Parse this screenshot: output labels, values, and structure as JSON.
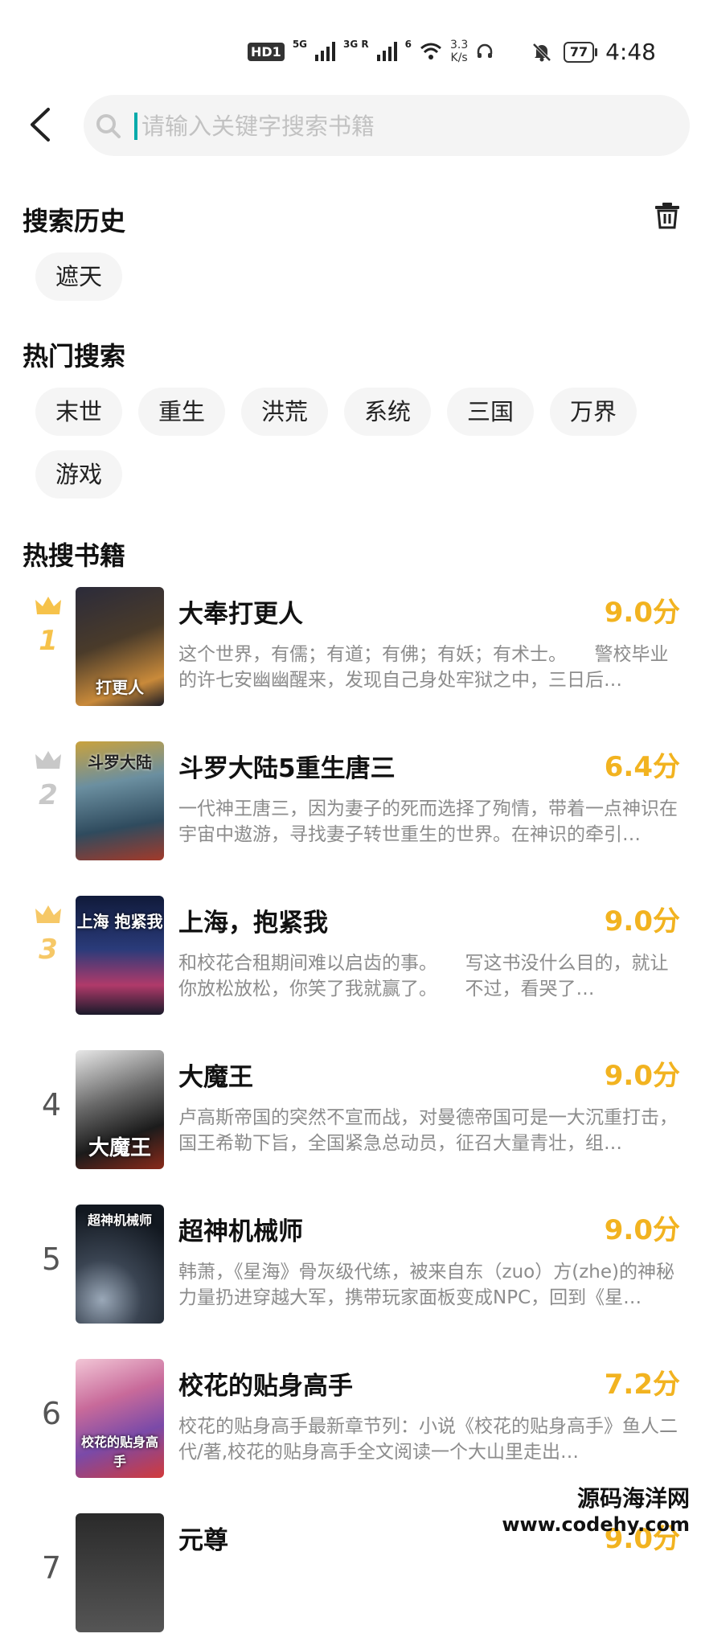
{
  "status_bar": {
    "hd": "HD",
    "sim": "1",
    "net1": "5G",
    "net2": "3G R",
    "wifi_gen": "6",
    "speed_value": "3.3",
    "speed_unit": "K/s",
    "battery": "77",
    "time": "4:48"
  },
  "search": {
    "placeholder": "请输入关键字搜索书籍"
  },
  "history": {
    "title": "搜索历史",
    "items": [
      "遮天"
    ]
  },
  "hot": {
    "title": "热门搜索",
    "items": [
      "末世",
      "重生",
      "洪荒",
      "系统",
      "三国",
      "万界",
      "游戏"
    ]
  },
  "books": {
    "title": "热搜书籍",
    "items": [
      {
        "rank": "1",
        "title": "大奉打更人",
        "score": "9.0分",
        "desc": "这个世界，有儒；有道；有佛；有妖；有术士。　　警校毕业的许七安幽幽醒来，发现自己身处牢狱之中，三日后…",
        "cover_text": "打更人"
      },
      {
        "rank": "2",
        "title": "斗罗大陆5重生唐三",
        "score": "6.4分",
        "desc": "一代神王唐三，因为妻子的死而选择了殉情，带着一点神识在宇宙中遨游，寻找妻子转世重生的世界。在神识的牵引…",
        "cover_text": "斗罗大陆"
      },
      {
        "rank": "3",
        "title": "上海，抱紧我",
        "score": "9.0分",
        "desc": "和校花合租期间难以启齿的事。　　写这书没什么目的，就让你放松放松，你笑了我就赢了。　　不过，看哭了…",
        "cover_text": "上海 抱紧我"
      },
      {
        "rank": "4",
        "title": "大魔王",
        "score": "9.0分",
        "desc": "卢高斯帝国的突然不宣而战，对曼德帝国可是一大沉重打击，国王希勒下旨，全国紧急总动员，征召大量青壮，组…",
        "cover_text": "大魔王"
      },
      {
        "rank": "5",
        "title": "超神机械师",
        "score": "9.0分",
        "desc": "韩萧，《星海》骨灰级代练，被来自东（zuo）方(zhe)的神秘力量扔进穿越大军，携带玩家面板变成NPC，回到《星…",
        "cover_text": "超神机械师"
      },
      {
        "rank": "6",
        "title": "校花的贴身高手",
        "score": "7.2分",
        "desc": "校花的贴身高手最新章节列：小说《校花的贴身高手》鱼人二代/著,校花的贴身高手全文阅读一个大山里走出…",
        "cover_text": "校花的贴身高手"
      },
      {
        "rank": "7",
        "title": "元尊",
        "score": "9.0分",
        "desc": "",
        "cover_text": ""
      }
    ]
  },
  "watermark": {
    "line1": "源码海洋网",
    "line2": "www.codehy.com"
  },
  "colors": {
    "score": "#f2b320",
    "chip_bg": "#f5f5f5",
    "crown_gold": "#f6c24a",
    "crown_silver": "#c8c8c8"
  }
}
